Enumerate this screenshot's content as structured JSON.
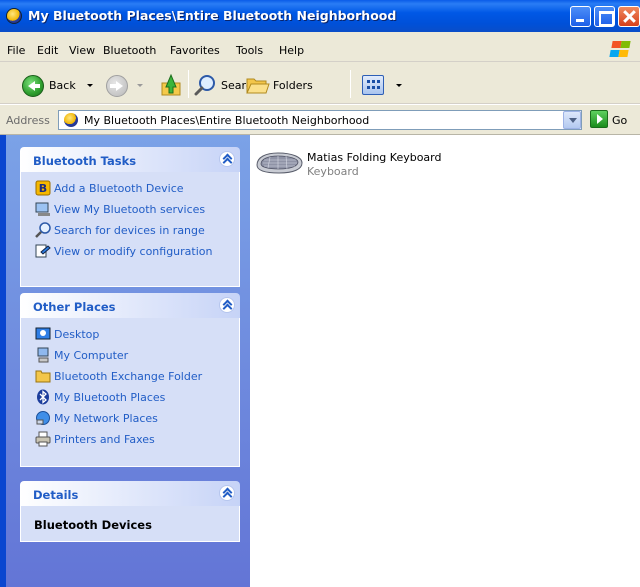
{
  "window": {
    "title": "My Bluetooth Places\\Entire Bluetooth Neighborhood",
    "controls": [
      "minimize",
      "maximize",
      "close"
    ]
  },
  "menu": [
    "File",
    "Edit",
    "View",
    "Bluetooth",
    "Favorites",
    "Tools",
    "Help"
  ],
  "toolbar": {
    "back_label": "Back",
    "search_label": "Search",
    "folders_label": "Folders"
  },
  "address": {
    "label": "Address",
    "value": "My Bluetooth Places\\Entire Bluetooth Neighborhood",
    "go_label": "Go"
  },
  "sidebar": {
    "bluetooth_tasks": {
      "title": "Bluetooth Tasks",
      "items": [
        {
          "label": "Add a Bluetooth Device",
          "icon": "bluetooth-add-icon"
        },
        {
          "label": "View My Bluetooth services",
          "icon": "services-icon"
        },
        {
          "label": "Search for devices in range",
          "icon": "search-icon"
        },
        {
          "label": "View or modify configuration",
          "icon": "configuration-icon"
        }
      ]
    },
    "other_places": {
      "title": "Other Places",
      "items": [
        {
          "label": "Desktop",
          "icon": "desktop-icon"
        },
        {
          "label": "My Computer",
          "icon": "computer-icon"
        },
        {
          "label": "Bluetooth Exchange Folder",
          "icon": "folder-icon"
        },
        {
          "label": "My Bluetooth Places",
          "icon": "bluetooth-icon"
        },
        {
          "label": "My Network Places",
          "icon": "network-icon"
        },
        {
          "label": "Printers and Faxes",
          "icon": "printer-icon"
        }
      ]
    },
    "details": {
      "title": "Details",
      "text": "Bluetooth Devices"
    }
  },
  "devices": [
    {
      "name": "Matias Folding Keyboard",
      "type": "Keyboard",
      "icon": "keyboard-icon"
    }
  ],
  "colors": {
    "titlebar": "#0054e3",
    "task_link": "#215dc6",
    "sidebar_gradient_top": "#7ba2e7",
    "sidebar_gradient_bottom": "#6375d6",
    "panel_body": "#d6dff7",
    "chrome": "#ece9d8"
  }
}
